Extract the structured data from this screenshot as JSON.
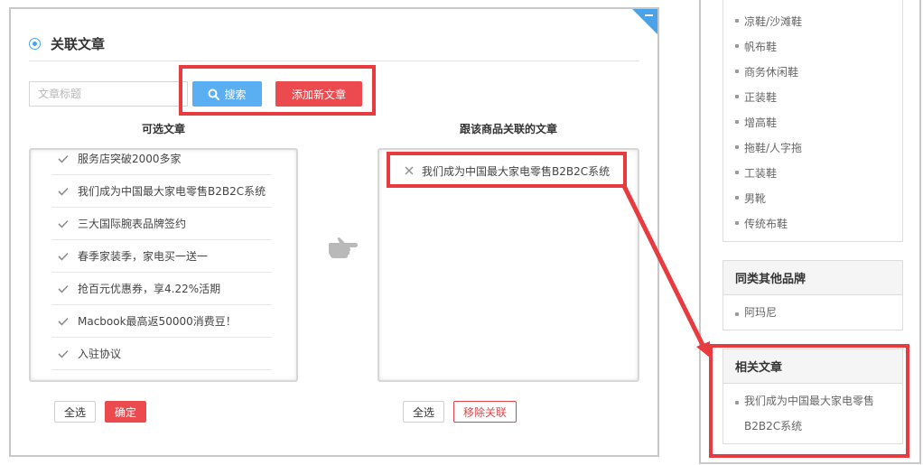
{
  "panel": {
    "title": "关联文章",
    "search_placeholder": "文章标题",
    "search_button": "搜索",
    "add_button": "添加新文章",
    "available_title": "可选文章",
    "linked_title": "跟该商品关联的文章",
    "available_items": [
      "服务店突破2000多家",
      "我们成为中国最大家电零售B2B2C系统",
      "三大国际腕表品牌签约",
      "春季家装季，家电买一送一",
      "抢百元优惠券，享4.22%活期",
      "Macbook最高返50000消费豆！",
      "入驻协议"
    ],
    "linked_items": [
      "我们成为中国最大家电零售B2B2C系统"
    ],
    "select_all_left": "全选",
    "confirm": "确定",
    "select_all_right": "全选",
    "remove_link": "移除关联",
    "accent_blue": "#5aaef2",
    "accent_red": "#eb4b4f"
  },
  "sidebar": {
    "categories": [
      "凉鞋/沙滩鞋",
      "帆布鞋",
      "商务休闲鞋",
      "正装鞋",
      "增高鞋",
      "拖鞋/人字拖",
      "工装鞋",
      "男靴",
      "传统布鞋"
    ],
    "brands_title": "同类其他品牌",
    "brands": [
      "阿玛尼"
    ],
    "related_title": "相关文章",
    "related": [
      "我们成为中国最大家电零售B2B2C系统"
    ]
  },
  "highlight_color": "#e83b3f"
}
